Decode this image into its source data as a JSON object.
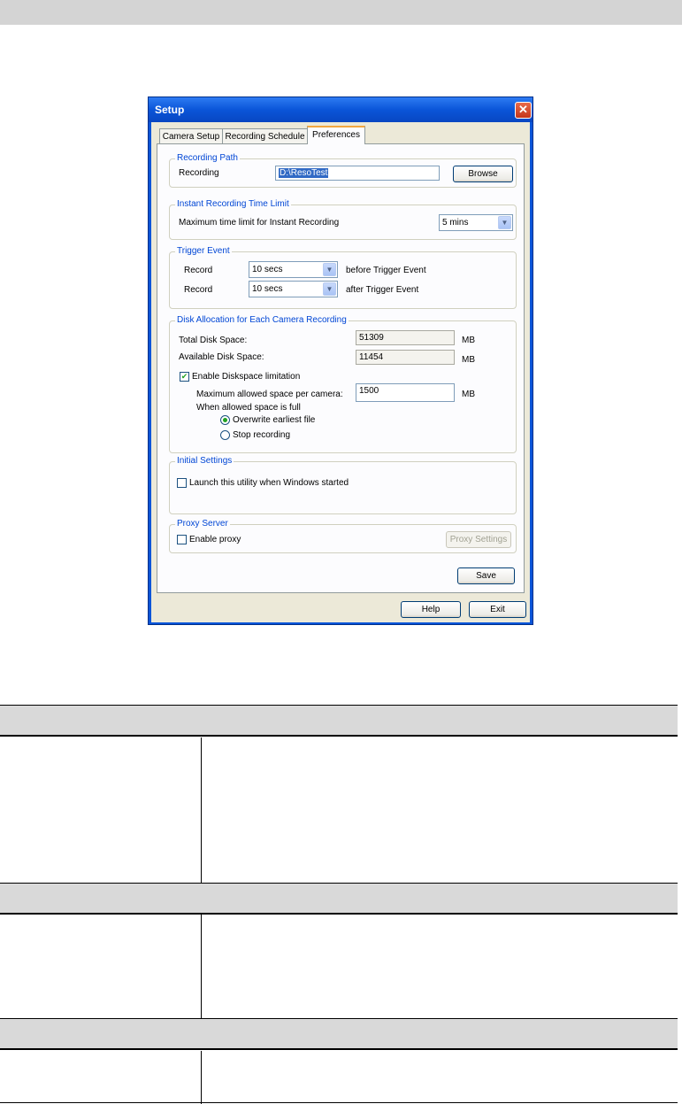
{
  "window": {
    "title": "Setup",
    "close_glyph": "✕",
    "tabs": [
      "Camera Setup",
      "Recording Schedule",
      "Preferences"
    ],
    "active_tab": "Preferences"
  },
  "recording_path": {
    "group_label": "Recording Path",
    "label": "Recording",
    "value": "D:\\ResoTest",
    "browse_label": "Browse"
  },
  "instant_recording": {
    "group_label": "Instant Recording Time Limit",
    "label": "Maximum time limit for Instant Recording",
    "value": "5 mins"
  },
  "trigger_event": {
    "group_label": "Trigger Event",
    "rows": [
      {
        "label": "Record",
        "value": "10 secs",
        "suffix": "before Trigger Event"
      },
      {
        "label": "Record",
        "value": "10 secs",
        "suffix": "after Trigger Event"
      }
    ]
  },
  "disk_allocation": {
    "group_label": "Disk Allocation for Each Camera Recording",
    "total_label": "Total Disk Space:",
    "total_value": "51309",
    "available_label": "Available Disk Space:",
    "available_value": "11454",
    "unit": "MB",
    "enable_label": "Enable Diskspace limitation",
    "enable_checked": true,
    "max_label": "Maximum allowed space per camera:",
    "max_value": "1500",
    "when_full_label": "When allowed space is full",
    "options": [
      "Overwrite earliest file",
      "Stop recording"
    ],
    "selected_option": "Overwrite earliest file"
  },
  "initial_settings": {
    "group_label": "Initial Settings",
    "launch_label": "Launch this utility when Windows started",
    "launch_checked": false
  },
  "proxy": {
    "group_label": "Proxy Server",
    "enable_label": "Enable proxy",
    "enable_checked": false,
    "settings_label": "Proxy Settings"
  },
  "buttons": {
    "save": "Save",
    "help": "Help",
    "exit": "Exit"
  },
  "colors": {
    "titlebar": "#0a55d8",
    "close_button": "#d4492a",
    "dialog_face": "#ece9d8",
    "group_label": "#0046d5",
    "table_header": "#d9d9d9"
  },
  "icons": {
    "close": "close-icon",
    "dropdown": "chevron-down-icon",
    "check": "checkmark-icon"
  }
}
